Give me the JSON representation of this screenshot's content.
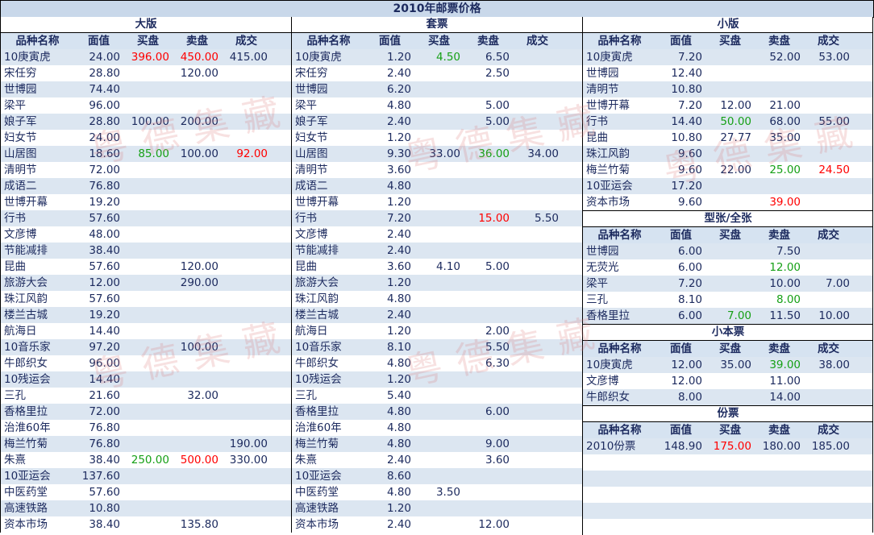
{
  "title": "2010年邮票价格",
  "headers": [
    "品种名称",
    "面值",
    "买盘",
    "卖盘",
    "成交"
  ],
  "colors": {
    "header_bg": "#c9d8ea",
    "stripe": "#dce6f1",
    "red": "#ff0000",
    "green": "#16a016"
  },
  "watermark": "粤德集藏",
  "sections": {
    "large": {
      "label": "大版",
      "rows": [
        {
          "name": "10庚寅虎",
          "face": "24.00",
          "buy": "396.00",
          "buy_c": "red",
          "sell": "450.00",
          "sell_c": "red",
          "deal": "415.00"
        },
        {
          "name": "宋任穷",
          "face": "28.80",
          "buy": "",
          "sell": "120.00",
          "deal": ""
        },
        {
          "name": "世博园",
          "face": "74.40",
          "buy": "",
          "sell": "",
          "deal": ""
        },
        {
          "name": "梁平",
          "face": "96.00",
          "buy": "",
          "sell": "",
          "deal": ""
        },
        {
          "name": "娘子军",
          "face": "28.80",
          "buy": "100.00",
          "sell": "200.00",
          "deal": ""
        },
        {
          "name": "妇女节",
          "face": "24.00",
          "buy": "",
          "sell": "",
          "deal": ""
        },
        {
          "name": "山居图",
          "face": "18.60",
          "buy": "85.00",
          "buy_c": "green",
          "sell": "100.00",
          "deal": "92.00",
          "deal_c": "red"
        },
        {
          "name": "清明节",
          "face": "72.00",
          "buy": "",
          "sell": "",
          "deal": ""
        },
        {
          "name": "成语二",
          "face": "76.80",
          "buy": "",
          "sell": "",
          "deal": ""
        },
        {
          "name": "世博开幕",
          "face": "19.20",
          "buy": "",
          "sell": "",
          "deal": ""
        },
        {
          "name": "行书",
          "face": "57.60",
          "buy": "",
          "sell": "",
          "deal": ""
        },
        {
          "name": "文彦博",
          "face": "48.00",
          "buy": "",
          "sell": "",
          "deal": ""
        },
        {
          "name": "节能减排",
          "face": "38.40",
          "buy": "",
          "sell": "",
          "deal": ""
        },
        {
          "name": "昆曲",
          "face": "57.60",
          "buy": "",
          "sell": "120.00",
          "deal": ""
        },
        {
          "name": "旅游大会",
          "face": "12.00",
          "buy": "",
          "sell": "290.00",
          "deal": ""
        },
        {
          "name": "珠江风韵",
          "face": "57.60",
          "buy": "",
          "sell": "",
          "deal": ""
        },
        {
          "name": "楼兰古城",
          "face": "19.20",
          "buy": "",
          "sell": "",
          "deal": ""
        },
        {
          "name": "航海日",
          "face": "14.40",
          "buy": "",
          "sell": "",
          "deal": ""
        },
        {
          "name": "10音乐家",
          "face": "97.20",
          "buy": "",
          "sell": "100.00",
          "deal": ""
        },
        {
          "name": "牛郎织女",
          "face": "96.00",
          "buy": "",
          "sell": "",
          "deal": ""
        },
        {
          "name": "10残运会",
          "face": "14.40",
          "buy": "",
          "sell": "",
          "deal": ""
        },
        {
          "name": "三孔",
          "face": "21.60",
          "buy": "",
          "sell": "32.00",
          "deal": ""
        },
        {
          "name": "香格里拉",
          "face": "72.00",
          "buy": "",
          "sell": "",
          "deal": ""
        },
        {
          "name": "治淮60年",
          "face": "76.80",
          "buy": "",
          "sell": "",
          "deal": ""
        },
        {
          "name": "梅兰竹菊",
          "face": "76.80",
          "buy": "",
          "sell": "",
          "deal": "190.00"
        },
        {
          "name": "朱熹",
          "face": "38.40",
          "buy": "250.00",
          "buy_c": "green",
          "sell": "500.00",
          "sell_c": "red",
          "deal": "330.00"
        },
        {
          "name": "10亚运会",
          "face": "137.60",
          "buy": "",
          "sell": "",
          "deal": ""
        },
        {
          "name": "中医药堂",
          "face": "57.60",
          "buy": "",
          "sell": "",
          "deal": ""
        },
        {
          "name": "高速铁路",
          "face": "10.80",
          "buy": "",
          "sell": "",
          "deal": ""
        },
        {
          "name": "资本市场",
          "face": "38.40",
          "buy": "",
          "sell": "135.80",
          "deal": ""
        }
      ]
    },
    "sets": {
      "label": "套票",
      "rows": [
        {
          "name": "10庚寅虎",
          "face": "1.20",
          "buy": "4.50",
          "buy_c": "green",
          "sell": "6.50",
          "deal": ""
        },
        {
          "name": "宋任穷",
          "face": "2.40",
          "buy": "",
          "sell": "2.50",
          "deal": ""
        },
        {
          "name": "世博园",
          "face": "6.20",
          "buy": "",
          "sell": "",
          "deal": ""
        },
        {
          "name": "梁平",
          "face": "4.80",
          "buy": "",
          "sell": "5.00",
          "deal": ""
        },
        {
          "name": "娘子军",
          "face": "2.40",
          "buy": "",
          "sell": "5.00",
          "deal": ""
        },
        {
          "name": "妇女节",
          "face": "1.20",
          "buy": "",
          "sell": "",
          "deal": ""
        },
        {
          "name": "山居图",
          "face": "9.30",
          "buy": "33.00",
          "sell": "36.00",
          "sell_c": "green",
          "deal": "34.00"
        },
        {
          "name": "清明节",
          "face": "3.60",
          "buy": "",
          "sell": "",
          "deal": ""
        },
        {
          "name": "成语二",
          "face": "4.80",
          "buy": "",
          "sell": "",
          "deal": ""
        },
        {
          "name": "世博开幕",
          "face": "1.20",
          "buy": "",
          "sell": "",
          "deal": ""
        },
        {
          "name": "行书",
          "face": "7.20",
          "buy": "",
          "sell": "15.00",
          "sell_c": "red",
          "deal": "5.50"
        },
        {
          "name": "文彦博",
          "face": "2.40",
          "buy": "",
          "sell": "",
          "deal": ""
        },
        {
          "name": "节能减排",
          "face": "2.40",
          "buy": "",
          "sell": "",
          "deal": ""
        },
        {
          "name": "昆曲",
          "face": "3.60",
          "buy": "4.10",
          "sell": "5.00",
          "deal": ""
        },
        {
          "name": "旅游大会",
          "face": "1.20",
          "buy": "",
          "sell": "",
          "deal": ""
        },
        {
          "name": "珠江风韵",
          "face": "4.80",
          "buy": "",
          "sell": "",
          "deal": ""
        },
        {
          "name": "楼兰古城",
          "face": "2.40",
          "buy": "",
          "sell": "",
          "deal": ""
        },
        {
          "name": "航海日",
          "face": "1.20",
          "buy": "",
          "sell": "2.00",
          "deal": ""
        },
        {
          "name": "10音乐家",
          "face": "8.10",
          "buy": "",
          "sell": "5.50",
          "deal": ""
        },
        {
          "name": "牛郎织女",
          "face": "4.80",
          "buy": "",
          "sell": "6.30",
          "deal": ""
        },
        {
          "name": "10残运会",
          "face": "1.20",
          "buy": "",
          "sell": "",
          "deal": ""
        },
        {
          "name": "三孔",
          "face": "5.40",
          "buy": "",
          "sell": "",
          "deal": ""
        },
        {
          "name": "香格里拉",
          "face": "4.80",
          "buy": "",
          "sell": "6.00",
          "deal": ""
        },
        {
          "name": "治淮60年",
          "face": "4.80",
          "buy": "",
          "sell": "",
          "deal": ""
        },
        {
          "name": "梅兰竹菊",
          "face": "4.80",
          "buy": "",
          "sell": "9.00",
          "deal": ""
        },
        {
          "name": "朱熹",
          "face": "2.40",
          "buy": "",
          "sell": "3.60",
          "deal": ""
        },
        {
          "name": "10亚运会",
          "face": "8.60",
          "buy": "",
          "sell": "",
          "deal": ""
        },
        {
          "name": "中医药堂",
          "face": "4.80",
          "buy": "3.50",
          "sell": "",
          "deal": ""
        },
        {
          "name": "高速铁路",
          "face": "1.20",
          "buy": "",
          "sell": "",
          "deal": ""
        },
        {
          "name": "资本市场",
          "face": "2.40",
          "buy": "",
          "sell": "12.00",
          "deal": ""
        }
      ]
    },
    "small": {
      "label": "小版",
      "rows": [
        {
          "name": "10庚寅虎",
          "face": "7.20",
          "buy": "",
          "sell": "52.00",
          "deal": "53.00"
        },
        {
          "name": "世博园",
          "face": "12.40",
          "buy": "",
          "sell": "",
          "deal": ""
        },
        {
          "name": "清明节",
          "face": "10.80",
          "buy": "",
          "sell": "",
          "deal": ""
        },
        {
          "name": "世博开幕",
          "face": "7.20",
          "buy": "12.00",
          "sell": "21.00",
          "deal": ""
        },
        {
          "name": "行书",
          "face": "14.40",
          "buy": "50.00",
          "buy_c": "green",
          "sell": "68.00",
          "deal": "55.00"
        },
        {
          "name": "昆曲",
          "face": "10.80",
          "buy": "27.77",
          "sell": "35.00",
          "deal": ""
        },
        {
          "name": "珠江风韵",
          "face": "9.60",
          "buy": "",
          "sell": "",
          "deal": ""
        },
        {
          "name": "梅兰竹菊",
          "face": "9.60",
          "buy": "22.00",
          "sell": "25.00",
          "sell_c": "green",
          "deal": "24.50",
          "deal_c": "red"
        },
        {
          "name": "10亚运会",
          "face": "17.20",
          "buy": "",
          "sell": "",
          "deal": ""
        },
        {
          "name": "资本市场",
          "face": "9.60",
          "buy": "",
          "sell": "39.00",
          "sell_c": "red",
          "deal": ""
        }
      ]
    },
    "sheets": {
      "label": "型张/全张",
      "rows": [
        {
          "name": "世博园",
          "face": "6.00",
          "buy": "",
          "sell": "7.50",
          "deal": ""
        },
        {
          "name": "无荧光",
          "face": "6.00",
          "buy": "",
          "sell": "12.00",
          "sell_c": "green",
          "deal": ""
        },
        {
          "name": "梁平",
          "face": "7.20",
          "buy": "",
          "sell": "10.00",
          "deal": "7.00"
        },
        {
          "name": "三孔",
          "face": "8.10",
          "buy": "",
          "sell": "8.00",
          "sell_c": "green",
          "deal": ""
        },
        {
          "name": "香格里拉",
          "face": "6.00",
          "buy": "7.00",
          "buy_c": "green",
          "sell": "11.50",
          "deal": "10.00"
        }
      ]
    },
    "booklets": {
      "label": "小本票",
      "rows": [
        {
          "name": "10庚寅虎",
          "face": "12.00",
          "buy": "35.00",
          "sell": "39.00",
          "sell_c": "green",
          "deal": "38.00"
        },
        {
          "name": "文彦博",
          "face": "12.00",
          "buy": "",
          "sell": "11.00",
          "deal": ""
        },
        {
          "name": "牛郎织女",
          "face": "8.00",
          "buy": "",
          "sell": "14.00",
          "deal": ""
        }
      ]
    },
    "annual": {
      "label": "份票",
      "rows": [
        {
          "name": "2010份票",
          "face": "148.90",
          "buy": "175.00",
          "buy_c": "red",
          "sell": "180.00",
          "deal": "185.00"
        }
      ]
    }
  }
}
